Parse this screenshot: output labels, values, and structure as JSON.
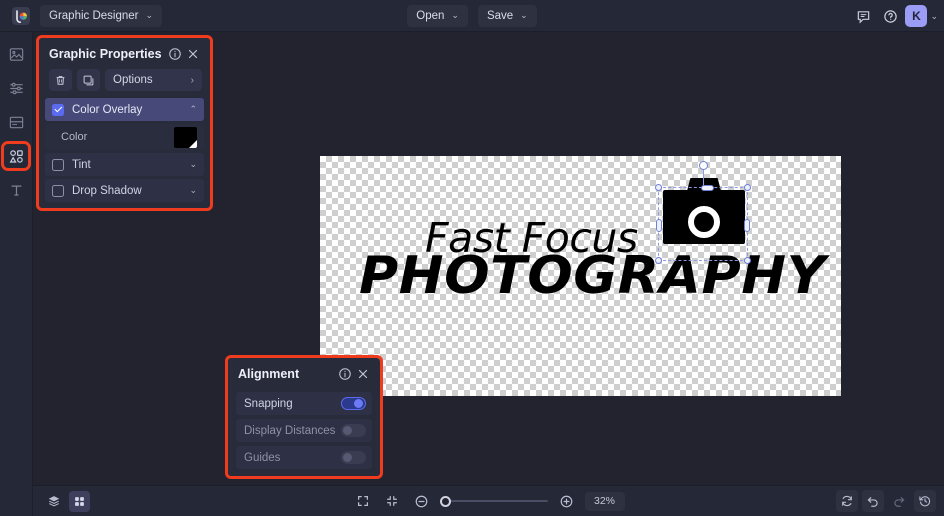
{
  "header": {
    "logo_icon": "brand-logo-icon",
    "app_menu_label": "Graphic Designer",
    "open_label": "Open",
    "save_label": "Save",
    "comment_icon": "comment-icon",
    "help_icon": "help-circle-icon",
    "avatar_initial": "K",
    "avatar_color": "#9a9cf5",
    "caret": "⌄"
  },
  "sidebar": {
    "items": [
      {
        "name": "image-icon",
        "label": "Image"
      },
      {
        "name": "adjustments-icon",
        "label": "Adjustments"
      },
      {
        "name": "layout-icon",
        "label": "Layout"
      },
      {
        "name": "shapes-icon",
        "label": "Shapes"
      },
      {
        "name": "text-icon",
        "label": "Text"
      }
    ],
    "active_index": 3,
    "highlight_color": "#f03c1e"
  },
  "graphic_properties": {
    "title": "Graphic Properties",
    "info_icon": "info-icon",
    "close_icon": "close-icon",
    "delete_icon": "trash-icon",
    "duplicate_icon": "duplicate-icon",
    "options_label": "Options",
    "options_chevron": "›",
    "effects": [
      {
        "label": "Color Overlay",
        "checked": true,
        "expanded": true,
        "chevron": "⌃"
      },
      {
        "label": "Tint",
        "checked": false,
        "expanded": false,
        "chevron": "⌄"
      },
      {
        "label": "Drop Shadow",
        "checked": false,
        "expanded": false,
        "chevron": "⌄"
      }
    ],
    "color_row": {
      "label": "Color",
      "swatch_hex": "#000000"
    }
  },
  "alignment": {
    "title": "Alignment",
    "info_icon": "info-icon",
    "close_icon": "close-icon",
    "rows": [
      {
        "label": "Snapping",
        "on": true
      },
      {
        "label": "Display Distances",
        "on": false
      },
      {
        "label": "Guides",
        "on": false
      }
    ]
  },
  "canvas": {
    "logo_line1": "Fast Focus",
    "logo_line2": "PHOTOGRAPHY",
    "camera_icon": "camera-icon",
    "selection": {
      "handles": 8,
      "rotate_handle": true
    }
  },
  "bottombar": {
    "layers_icon": "layers-icon",
    "grid_icon": "grid-icon",
    "fit_screen_icon": "fit-screen-icon",
    "fit_selection_icon": "fit-selection-icon",
    "zoom_out_icon": "zoom-out-icon",
    "zoom_in_icon": "zoom-in-icon",
    "zoom_level": "32%",
    "refresh_icon": "refresh-icon",
    "undo_icon": "undo-icon",
    "redo_icon": "redo-icon",
    "history_icon": "history-icon"
  }
}
